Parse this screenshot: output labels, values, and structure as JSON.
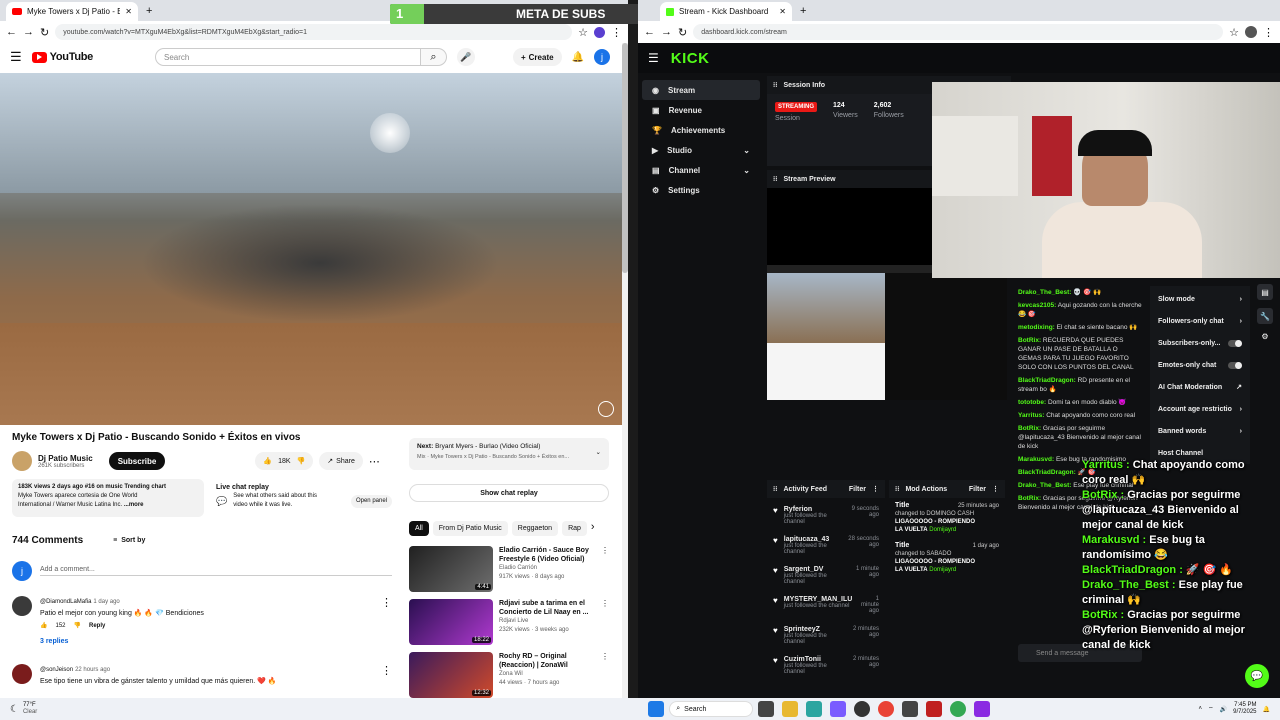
{
  "left_browser": {
    "tab_title": "Myke Towers x Dj Patio - B",
    "url": "youtube.com/watch?v=MTXguM4EbXg&list=RDMTXguM4EbXg&start_radio=1",
    "search_placeholder": "Search",
    "create_label": "Create",
    "avatar_letter": "j",
    "logo_text": "YouTube",
    "video_title": "Myke Towers x Dj Patio - Buscando Sonido + Éxitos en vivos",
    "channel_name": "Dj Patio Music",
    "subscribers": "261K subscribers",
    "subscribe_label": "Subscribe",
    "likes": "18K",
    "share_label": "Share",
    "views_line": "183K views  2 days ago  #16 on music Trending chart",
    "desc_line1": "Myke Towers aparece cortesia de One World",
    "desc_line2": "International / Warner Music Latina Inc.",
    "more_label": "...more",
    "live_chat_title": "Live chat replay",
    "live_chat_desc1": "See what others said about this",
    "live_chat_desc2": "video while it was live.",
    "open_panel": "Open panel",
    "show_chat_replay": "Show chat replay",
    "next_label": "Next:",
    "next_title": "Bryant Myers - Burlao (Video Oficial)",
    "next_sub": "Mix · Myke Towers x Dj Patio - Buscando Sonido + Éxitos en...",
    "comments_count": "744 Comments",
    "sort_by": "Sort by",
    "add_comment": "Add a comment...",
    "comment_avatar": "j",
    "chips": [
      "All",
      "From Dj Patio Music",
      "Reggaeton",
      "Rap"
    ],
    "comments": [
      {
        "user": "@DiamondLaMafia",
        "age": "1 day ago",
        "text": "Patio el mejor con young king 🔥 🔥 💎  Bendiciones",
        "likes": "152",
        "reply": "Reply",
        "replies": "3 replies"
      },
      {
        "user": "@sonJeison",
        "age": "22 hours ago",
        "text": "Ese tipo tiene un vibra de gánster talento y umildad que más quieren. ❤️ 🔥"
      }
    ],
    "recommended": [
      {
        "title": "Eladio Carrión - Sauce Boy Freestyle 6 (Video Oficial)",
        "channel": "Eladio Carrión",
        "meta": "917K views · 8 days ago",
        "duration": "4:41"
      },
      {
        "title": "Rdjavi sube a tarima en el Concierto de Lil Naay en ...",
        "channel": "Rdjavi Live",
        "meta": "232K views · 3 weeks ago",
        "duration": "18:22"
      },
      {
        "title": "Rochy RD – Original (Reaccion) | ZonaWil",
        "channel": "Zona Wil",
        "meta": "44 views · 7 hours ago",
        "duration": "12:32"
      }
    ]
  },
  "overlay": {
    "goal_title": "META DE SUBS",
    "goal_current": "1",
    "goal_target": "10",
    "goal_progress": 0.1
  },
  "right_browser": {
    "tab_title": "Stream - Kick Dashboard",
    "url": "dashboard.kick.com/stream",
    "logo": "KICK",
    "nav": [
      "Stream",
      "Revenue",
      "Achievements",
      "Studio",
      "Channel",
      "Settings"
    ],
    "session_info": "Session Info",
    "streaming_badge": "STREAMING",
    "session_label": "Session",
    "viewers_value": "124",
    "viewers_label": "Viewers",
    "followers_value": "2,602",
    "followers_label": "Followers",
    "stream_preview": "Stream Preview",
    "activity_feed": "Activity Feed",
    "mod_actions": "Mod Actions",
    "filter_label": "Filter",
    "activity": [
      {
        "name": "Ryferion",
        "desc": "just followed the channel",
        "time": "9 seconds ago"
      },
      {
        "name": "lapitucaza_43",
        "desc": "just followed the channel",
        "time": "28 seconds ago"
      },
      {
        "name": "Sargent_DV",
        "desc": "just followed the channel",
        "time": "1 minute ago"
      },
      {
        "name": "MYSTERY_MAN_ILU",
        "desc": "just followed the channel",
        "time": "1 minute ago"
      },
      {
        "name": "SprinteeyZ",
        "desc": "just followed the channel",
        "time": "2 minutes ago"
      },
      {
        "name": "CuzimTonii",
        "desc": "just followed the channel",
        "time": "2 minutes ago"
      }
    ],
    "mod": [
      {
        "title": "Title",
        "time": "25 minutes ago",
        "line1": "changed to DOMINGO CASH",
        "line2": "LIGAOOOOO - ROMPIENDO",
        "line3": "LA VUELTA",
        "by": "Domijayrd"
      },
      {
        "title": "Title",
        "time": "1 day ago",
        "line1": "changed to SABADO",
        "line2": "LIGAOOOOO - ROMPIENDO",
        "line3": "LA VUELTA",
        "by": "Domijayrd"
      }
    ],
    "chat": [
      {
        "user": "Drako_The_Best:",
        "text": "💀 🎯 🙌"
      },
      {
        "user": "kevcas2105:",
        "text": "Aqui gozando con la cherche 😂 🎯"
      },
      {
        "user": "metodixing:",
        "text": "El chat se siente bacano 🙌"
      },
      {
        "user": "BotRix:",
        "text": "RECUERDA QUE PUEDES GANAR UN PASE DE BATALLA O GEMAS PARA TU JUEGO FAVORITO SOLO CON LOS PUNTOS DEL CANAL"
      },
      {
        "user": "BlackTriadDragon:",
        "text": "RD presente en el stream bo 🔥"
      },
      {
        "user": "tototobe:",
        "text": "Domi ta en modo diablo 😈"
      },
      {
        "user": "Yarritus:",
        "text": "Chat apoyando como coro real"
      },
      {
        "user": "BotRix:",
        "text": "Gracias por seguirme @lapitucaza_43 Bienvenido al mejor canal de kick"
      },
      {
        "user": "Marakusvd:",
        "text": "Ese bug ta randomisimo"
      },
      {
        "user": "BlackTriadDragon:",
        "text": "🚀 🎯"
      },
      {
        "user": "Drako_The_Best:",
        "text": "Ese play fue criminal"
      },
      {
        "user": "BotRix:",
        "text": "Gracias por seguirme @Ryferion Bienvenido al mejor canal de kick"
      }
    ],
    "chat_placeholder": "Send a message",
    "settings_menu": [
      "Slow mode",
      "Followers-only chat",
      "Subscribers-only...",
      "Emotes-only chat",
      "AI Chat Moderation",
      "Account age restrictio",
      "Banned words",
      "Host Channel"
    ]
  },
  "chat_overlay": [
    {
      "user": "Yarritus :",
      "text": "Chat apoyando como coro real 🙌"
    },
    {
      "user": "BotRix :",
      "text": "Gracias por seguirme @lapitucaza_43 Bienvenido al mejor canal de kick"
    },
    {
      "user": "Marakusvd :",
      "text": "Ese bug ta randomísimo 😂"
    },
    {
      "user": "BlackTriadDragon :",
      "text": "🚀 🎯 🔥"
    },
    {
      "user": "Drako_The_Best :",
      "text": "Ese play fue criminal 🙌"
    },
    {
      "user": "BotRix :",
      "text": "Gracias por seguirme @Ryferion Bienvenido al mejor canal de kick"
    }
  ],
  "taskbar": {
    "weather_temp": "77°F",
    "weather_desc": "Clear",
    "search": "Search",
    "time": "7:45 PM",
    "date": "9/7/2025"
  },
  "colors": {
    "kick_green": "#53fc18",
    "yt_red": "#ff0000"
  }
}
